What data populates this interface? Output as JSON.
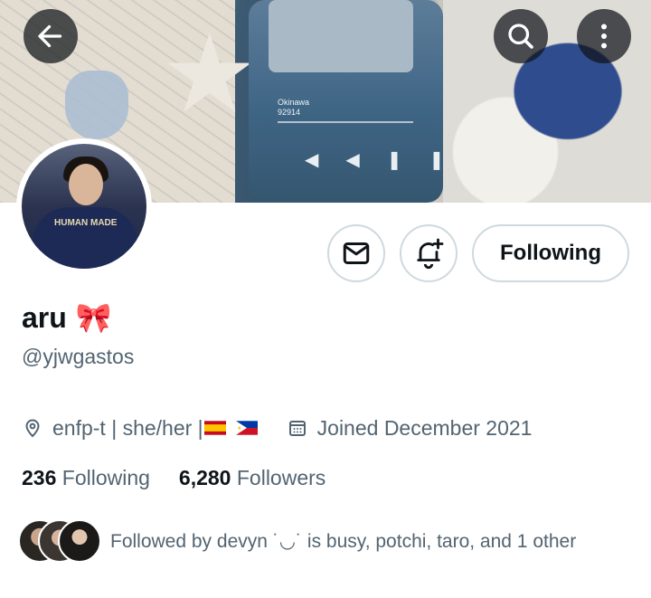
{
  "banner": {
    "song_title": "Okinawa",
    "song_number": "92914"
  },
  "header": {
    "back_icon": "arrow-left-icon",
    "search_icon": "search-icon",
    "more_icon": "more-vertical-icon"
  },
  "actions": {
    "message_icon": "envelope-icon",
    "notify_icon": "bell-plus-icon",
    "follow_label": "Following"
  },
  "profile": {
    "display_name": "aru",
    "name_emoji": "🎀",
    "handle": "@yjwgastos",
    "bio_location": "enfp-t | she/her | ",
    "joined": "Joined December 2021",
    "avatar_shirt_text": "HUMAN MADE"
  },
  "stats": {
    "following_count": "236",
    "following_label": "Following",
    "followers_count": "6,280",
    "followers_label": "Followers"
  },
  "followed_by": {
    "text": "Followed by devyn ˙◡˙ is busy, potchi, taro, and 1 other"
  },
  "colors": {
    "text_primary": "#0f1419",
    "text_secondary": "#536471",
    "border": "#cfd9de"
  }
}
